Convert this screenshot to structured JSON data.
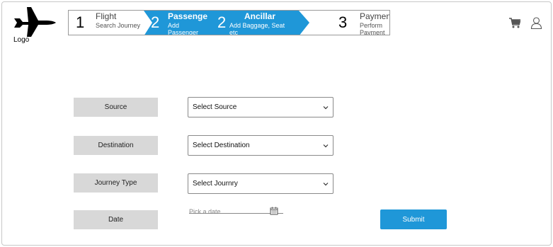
{
  "logo": {
    "label": "Logo",
    "icon": "fighter-jet-icon"
  },
  "stepper": {
    "steps": [
      {
        "number": "1",
        "title": "Flight",
        "subtitle": "Search Journey",
        "state": "inactive"
      },
      {
        "number": "2",
        "title": "Passenge",
        "subtitle": "Add Passenger",
        "state": "active"
      },
      {
        "number": "2",
        "title": "Ancillar",
        "subtitle": "Add Baggage, Seat etc",
        "state": "active"
      },
      {
        "number": "3",
        "title": "Payment",
        "subtitle": "Perform Payment",
        "state": "inactive"
      }
    ],
    "active_color": "#1f97d8"
  },
  "header": {
    "cart_icon": "shopping-cart-icon",
    "user_icon": "user-icon"
  },
  "form": {
    "source": {
      "label": "Source",
      "value": "Select Source"
    },
    "destination": {
      "label": "Destination",
      "value": "Select Destination"
    },
    "journey_type": {
      "label": "Journey Type",
      "value": "Select Journry"
    },
    "date": {
      "label": "Date",
      "placeholder": "Pick a date"
    },
    "submit_label": "Submit"
  },
  "colors": {
    "accent": "#1f97d8",
    "label_bg": "#d8d8d8"
  }
}
